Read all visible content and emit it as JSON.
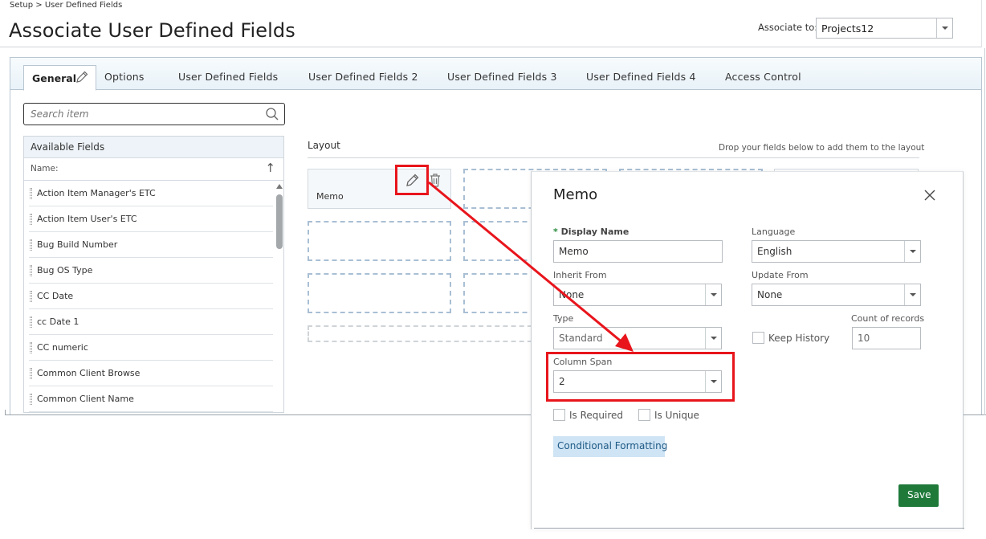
{
  "breadcrumb": "Setup > User Defined Fields",
  "page_title": "Associate User Defined Fields",
  "associate_to": {
    "label": "Associate to:",
    "value": "Projects12"
  },
  "tabs": [
    {
      "label": "General"
    },
    {
      "label": "Options"
    },
    {
      "label": "User Defined Fields"
    },
    {
      "label": "User Defined Fields 2"
    },
    {
      "label": "User Defined Fields 3"
    },
    {
      "label": "User Defined Fields 4"
    },
    {
      "label": "Access Control"
    }
  ],
  "search": {
    "placeholder": "Search item"
  },
  "available_fields": {
    "title": "Available Fields",
    "name_header": "Name:",
    "items": [
      "Action Item Manager's ETC",
      "Action Item User's ETC",
      "Bug Build Number",
      "Bug OS Type",
      "CC Date",
      "cc Date 1",
      "CC numeric",
      "Common Client Browse",
      "Common Client Name"
    ]
  },
  "layout": {
    "label": "Layout",
    "hint": "Drop your fields below to add them to the layout",
    "memo_field": "Memo"
  },
  "dialog": {
    "title": "Memo",
    "display_name_label": "Display Name",
    "display_name_value": "Memo",
    "language_label": "Language",
    "language_value": "English",
    "inherit_from_label": "Inherit From",
    "inherit_from_value": "None",
    "update_from_label": "Update From",
    "update_from_value": "None",
    "type_label": "Type",
    "type_value": "Standard",
    "keep_history_label": "Keep History",
    "count_of_records_label": "Count of records",
    "count_of_records_value": "10",
    "column_span_label": "Column Span",
    "column_span_value": "2",
    "is_required_label": "Is Required",
    "is_unique_label": "Is Unique",
    "conditional_formatting_label": "Conditional Formatting",
    "save_label": "Save"
  },
  "colors": {
    "accent_red": "#e8151c",
    "save_green": "#1f7a3a",
    "tab_bar": "#e8f2f8",
    "conditional_button": "#cfe4f4"
  },
  "icons": [
    "pencil-icon",
    "search-icon",
    "trash-icon",
    "close-icon",
    "chevron-down-icon",
    "sort-arrow-icon",
    "drag-handle-icon"
  ]
}
